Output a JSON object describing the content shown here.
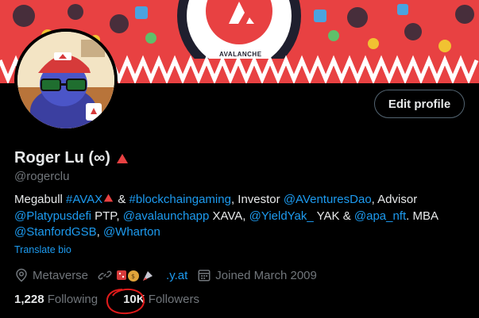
{
  "banner": {
    "logo_text": "AVALANCHE"
  },
  "profile": {
    "name": "Roger Lu (∞)",
    "name_icon": "red-triangle-icon",
    "handle": "@rogerclu",
    "edit_label": "Edit profile"
  },
  "bio": {
    "t1": "Megabull ",
    "l1": "#AVAX",
    "t2": " & ",
    "l2": "#blockchaingaming",
    "t3": ", Investor ",
    "l3": "@AVenturesDao",
    "t4": ", Advisor ",
    "l4": "@Platypusdefi",
    "t5": " PTP, ",
    "l5": "@avalaunchapp",
    "t6": " XAVA, ",
    "l6": "@YieldYak_",
    "t7": " YAK & ",
    "l7": "@apa_nft",
    "t8": ". MBA ",
    "l8": "@StanfordGSB",
    "t9": ", ",
    "l9": "@Wharton"
  },
  "translate_label": "Translate bio",
  "meta": {
    "location": "Metaverse",
    "link_text": ".y.at",
    "joined": "Joined March 2009"
  },
  "stats": {
    "following_count": "1,228",
    "following_label": "Following",
    "followers_count": "10K",
    "followers_label": "Followers"
  },
  "colors": {
    "link": "#1d9bf0",
    "avax_red": "#e84142",
    "muted": "#71767b"
  }
}
